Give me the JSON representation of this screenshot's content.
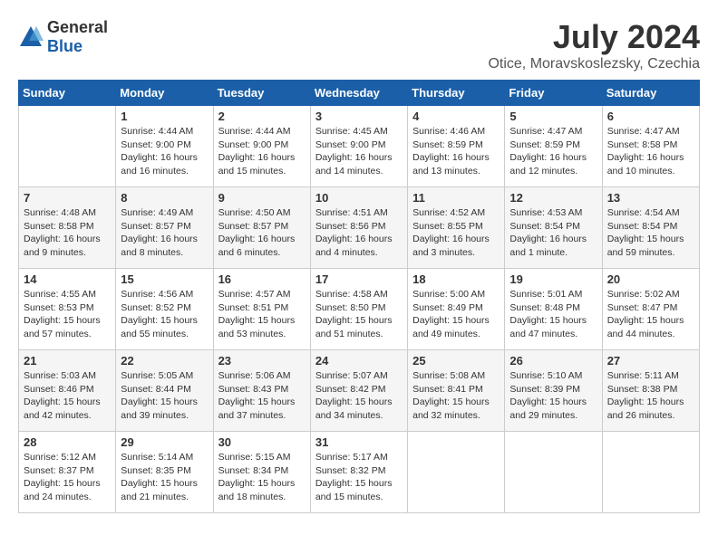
{
  "logo": {
    "general": "General",
    "blue": "Blue"
  },
  "title": {
    "month_year": "July 2024",
    "location": "Otice, Moravskoslezsky, Czechia"
  },
  "weekdays": [
    "Sunday",
    "Monday",
    "Tuesday",
    "Wednesday",
    "Thursday",
    "Friday",
    "Saturday"
  ],
  "weeks": [
    [
      {
        "day": "",
        "info": ""
      },
      {
        "day": "1",
        "info": "Sunrise: 4:44 AM\nSunset: 9:00 PM\nDaylight: 16 hours\nand 16 minutes."
      },
      {
        "day": "2",
        "info": "Sunrise: 4:44 AM\nSunset: 9:00 PM\nDaylight: 16 hours\nand 15 minutes."
      },
      {
        "day": "3",
        "info": "Sunrise: 4:45 AM\nSunset: 9:00 PM\nDaylight: 16 hours\nand 14 minutes."
      },
      {
        "day": "4",
        "info": "Sunrise: 4:46 AM\nSunset: 8:59 PM\nDaylight: 16 hours\nand 13 minutes."
      },
      {
        "day": "5",
        "info": "Sunrise: 4:47 AM\nSunset: 8:59 PM\nDaylight: 16 hours\nand 12 minutes."
      },
      {
        "day": "6",
        "info": "Sunrise: 4:47 AM\nSunset: 8:58 PM\nDaylight: 16 hours\nand 10 minutes."
      }
    ],
    [
      {
        "day": "7",
        "info": "Sunrise: 4:48 AM\nSunset: 8:58 PM\nDaylight: 16 hours\nand 9 minutes."
      },
      {
        "day": "8",
        "info": "Sunrise: 4:49 AM\nSunset: 8:57 PM\nDaylight: 16 hours\nand 8 minutes."
      },
      {
        "day": "9",
        "info": "Sunrise: 4:50 AM\nSunset: 8:57 PM\nDaylight: 16 hours\nand 6 minutes."
      },
      {
        "day": "10",
        "info": "Sunrise: 4:51 AM\nSunset: 8:56 PM\nDaylight: 16 hours\nand 4 minutes."
      },
      {
        "day": "11",
        "info": "Sunrise: 4:52 AM\nSunset: 8:55 PM\nDaylight: 16 hours\nand 3 minutes."
      },
      {
        "day": "12",
        "info": "Sunrise: 4:53 AM\nSunset: 8:54 PM\nDaylight: 16 hours\nand 1 minute."
      },
      {
        "day": "13",
        "info": "Sunrise: 4:54 AM\nSunset: 8:54 PM\nDaylight: 15 hours\nand 59 minutes."
      }
    ],
    [
      {
        "day": "14",
        "info": "Sunrise: 4:55 AM\nSunset: 8:53 PM\nDaylight: 15 hours\nand 57 minutes."
      },
      {
        "day": "15",
        "info": "Sunrise: 4:56 AM\nSunset: 8:52 PM\nDaylight: 15 hours\nand 55 minutes."
      },
      {
        "day": "16",
        "info": "Sunrise: 4:57 AM\nSunset: 8:51 PM\nDaylight: 15 hours\nand 53 minutes."
      },
      {
        "day": "17",
        "info": "Sunrise: 4:58 AM\nSunset: 8:50 PM\nDaylight: 15 hours\nand 51 minutes."
      },
      {
        "day": "18",
        "info": "Sunrise: 5:00 AM\nSunset: 8:49 PM\nDaylight: 15 hours\nand 49 minutes."
      },
      {
        "day": "19",
        "info": "Sunrise: 5:01 AM\nSunset: 8:48 PM\nDaylight: 15 hours\nand 47 minutes."
      },
      {
        "day": "20",
        "info": "Sunrise: 5:02 AM\nSunset: 8:47 PM\nDaylight: 15 hours\nand 44 minutes."
      }
    ],
    [
      {
        "day": "21",
        "info": "Sunrise: 5:03 AM\nSunset: 8:46 PM\nDaylight: 15 hours\nand 42 minutes."
      },
      {
        "day": "22",
        "info": "Sunrise: 5:05 AM\nSunset: 8:44 PM\nDaylight: 15 hours\nand 39 minutes."
      },
      {
        "day": "23",
        "info": "Sunrise: 5:06 AM\nSunset: 8:43 PM\nDaylight: 15 hours\nand 37 minutes."
      },
      {
        "day": "24",
        "info": "Sunrise: 5:07 AM\nSunset: 8:42 PM\nDaylight: 15 hours\nand 34 minutes."
      },
      {
        "day": "25",
        "info": "Sunrise: 5:08 AM\nSunset: 8:41 PM\nDaylight: 15 hours\nand 32 minutes."
      },
      {
        "day": "26",
        "info": "Sunrise: 5:10 AM\nSunset: 8:39 PM\nDaylight: 15 hours\nand 29 minutes."
      },
      {
        "day": "27",
        "info": "Sunrise: 5:11 AM\nSunset: 8:38 PM\nDaylight: 15 hours\nand 26 minutes."
      }
    ],
    [
      {
        "day": "28",
        "info": "Sunrise: 5:12 AM\nSunset: 8:37 PM\nDaylight: 15 hours\nand 24 minutes."
      },
      {
        "day": "29",
        "info": "Sunrise: 5:14 AM\nSunset: 8:35 PM\nDaylight: 15 hours\nand 21 minutes."
      },
      {
        "day": "30",
        "info": "Sunrise: 5:15 AM\nSunset: 8:34 PM\nDaylight: 15 hours\nand 18 minutes."
      },
      {
        "day": "31",
        "info": "Sunrise: 5:17 AM\nSunset: 8:32 PM\nDaylight: 15 hours\nand 15 minutes."
      },
      {
        "day": "",
        "info": ""
      },
      {
        "day": "",
        "info": ""
      },
      {
        "day": "",
        "info": ""
      }
    ]
  ]
}
